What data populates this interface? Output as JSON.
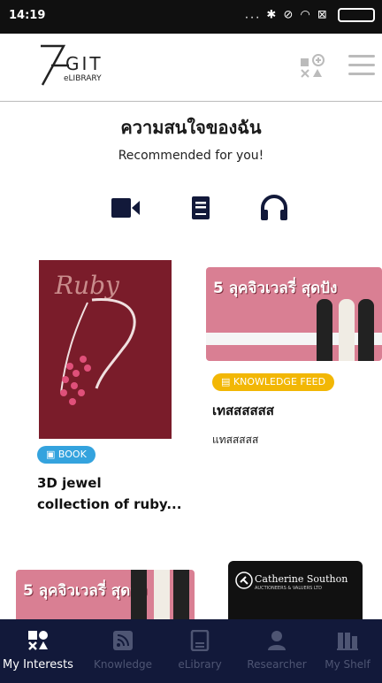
{
  "status_bar": {
    "time": "14:19",
    "icons": "... ✱ ⊘ ◠ ⊠"
  },
  "brand": {
    "git": "GIT",
    "elibrary": "eLIBRARY"
  },
  "heading": "ความสนใจของฉัน",
  "subheading": "Recommended for you!",
  "filters": [
    {
      "icon": "video-icon"
    },
    {
      "icon": "book-icon"
    },
    {
      "icon": "headphones-icon"
    }
  ],
  "cards": [
    {
      "cover_title": "Ruby",
      "badge": "BOOK",
      "title_line1": "3D jewel",
      "title_line2": "collection of ruby..."
    },
    {
      "banner_text": "5 ลุคจิวเวลรี่ สุดปัง",
      "badge": "KNOWLEDGE FEED",
      "title": "เทสสสสสส",
      "subtitle": "แทสสสสส"
    }
  ],
  "lower_cards": [
    {
      "banner_text": "5 ลุคจิวเวลรี่ สุดปัง"
    },
    {
      "name": "Catherine Southon",
      "sub": "AUCTIONEERS & VALUERS LTD"
    }
  ],
  "bottom_nav": [
    {
      "label": "My Interests",
      "active": true
    },
    {
      "label": "Knowledge",
      "active": false
    },
    {
      "label": "eLibrary",
      "active": false
    },
    {
      "label": "Researcher",
      "active": false
    },
    {
      "label": "My Shelf",
      "active": false
    }
  ],
  "colors": {
    "nav_bg": "#12193a",
    "book_badge": "#34a3de",
    "knowledge_badge": "#f2b705",
    "ruby_cover": "#7a1c2a",
    "banner_pink": "#d97f93"
  }
}
